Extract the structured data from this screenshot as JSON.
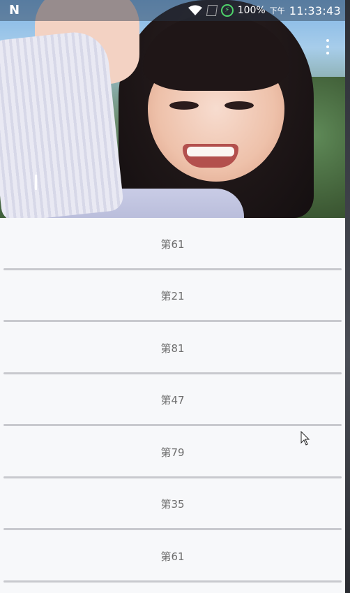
{
  "status_bar": {
    "battery": "100%",
    "ampm": "下午",
    "time": "11:33:43",
    "icons": [
      "notification-n-icon",
      "wifi-icon",
      "no-sim-icon",
      "battery-charging-icon"
    ]
  },
  "toolbar": {
    "menu_icon": "overflow-menu-icon"
  },
  "list": {
    "items": [
      {
        "label": "第61"
      },
      {
        "label": "第21"
      },
      {
        "label": "第81"
      },
      {
        "label": "第47"
      },
      {
        "label": "第79"
      },
      {
        "label": "第35"
      },
      {
        "label": "第61"
      }
    ]
  },
  "colors": {
    "list_background": "#f7f8fa",
    "list_text": "#6e6e6e",
    "divider": "#c8c9ce",
    "battery_accent": "#4fd46a"
  }
}
